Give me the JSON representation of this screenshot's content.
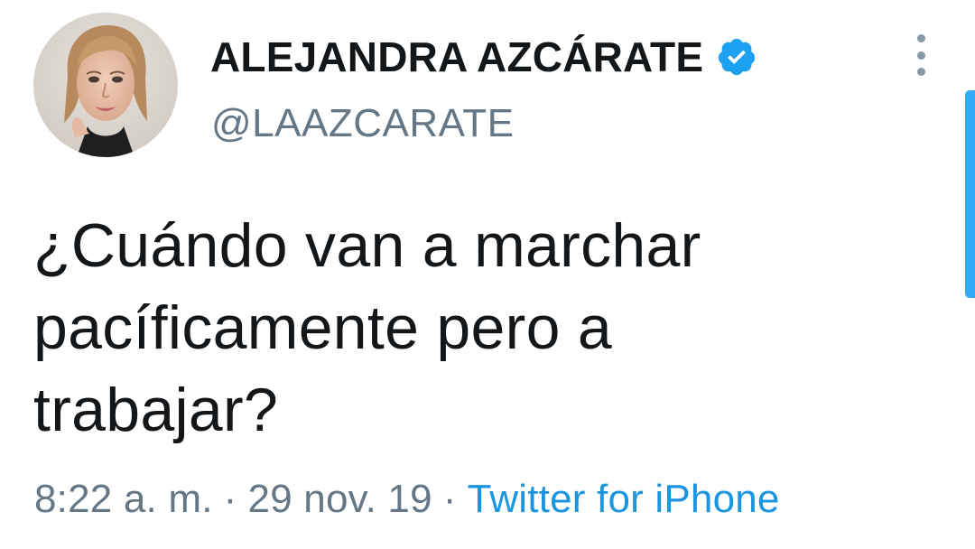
{
  "tweet": {
    "author": {
      "display_name": "ALEJANDRA AZCÁRATE",
      "handle": "@LAAZCARATE",
      "verified": true,
      "avatar_icon": "profile-photo"
    },
    "text_lines": [
      "¿Cuándo van a marchar",
      "pacíficamente pero a",
      "trabajar?"
    ],
    "time": "8:22 a. m.",
    "separator": "·",
    "date": "29 nov. 19",
    "source": "Twitter for iPhone"
  },
  "icons": {
    "verified": "verified-badge-icon",
    "more": "more-vertical-icon"
  },
  "colors": {
    "accent": "#1da1f2",
    "link": "#1b95e0",
    "secondary_text": "#657786",
    "primary_text": "#14171a"
  }
}
